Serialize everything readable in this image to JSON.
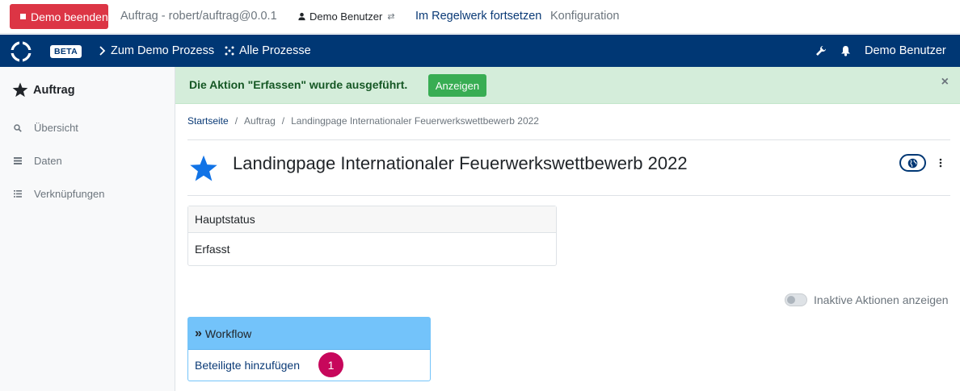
{
  "demo_bar": {
    "end_label": "Demo beenden",
    "title": "Auftrag - robert/auftrag@0.0.1",
    "user": "Demo Benutzer",
    "continue_label": "Im Regelwerk fortsetzen",
    "config_label": "Konfiguration"
  },
  "navbar": {
    "badge": "BETA",
    "demo_link": "Zum Demo Prozess",
    "all_link": "Alle Prozesse",
    "user": "Demo Benutzer",
    "bg_color": "#003774"
  },
  "sidebar": {
    "heading": "Auftrag",
    "items": [
      {
        "label": "Übersicht",
        "icon": "search-icon"
      },
      {
        "label": "Daten",
        "icon": "table-icon"
      },
      {
        "label": "Verknüpfungen",
        "icon": "list-icon"
      }
    ]
  },
  "alert": {
    "message": "Die Aktion \"Erfassen\" wurde ausgeführt.",
    "button": "Anzeigen",
    "close": "×"
  },
  "breadcrumb": {
    "home": "Startseite",
    "parent": "Auftrag",
    "current": "Landingpage Internationaler Feuerwerkswettbewerb 2022"
  },
  "page": {
    "title": "Landingpage Internationaler Feuerwerkswettbewerb 2022",
    "star_color": "#1173e6"
  },
  "status_card": {
    "header": "Hauptstatus",
    "value": "Erfasst"
  },
  "toggle": {
    "label": "Inaktive Aktionen anzeigen",
    "on": false
  },
  "workflow": {
    "header": "Workflow",
    "action": "Beteiligte hinzufügen",
    "badge": "1"
  }
}
